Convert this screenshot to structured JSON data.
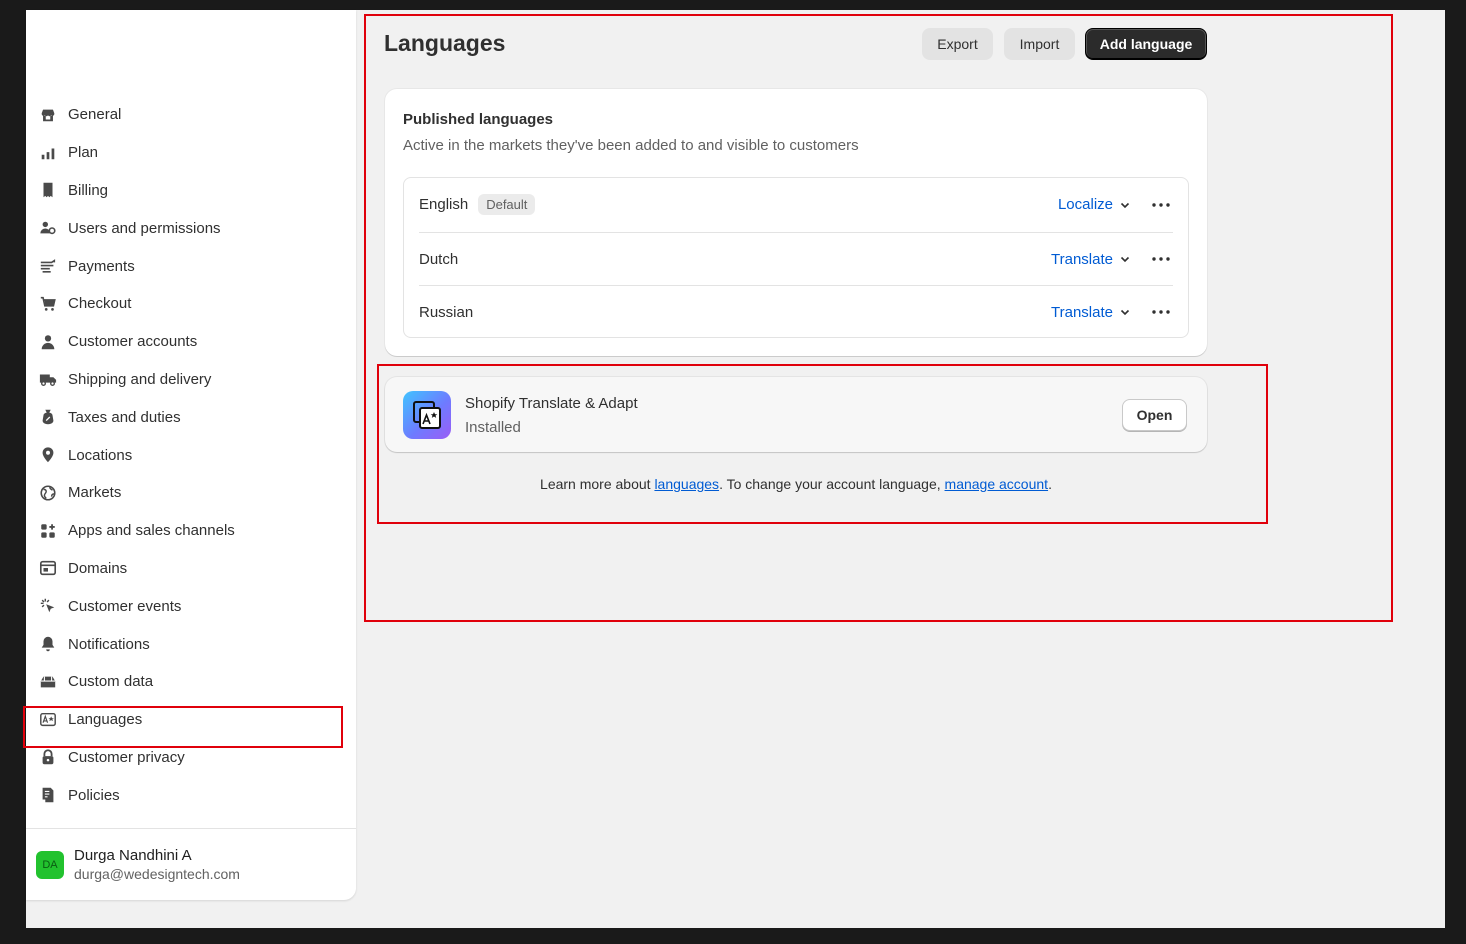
{
  "sidebar": {
    "items": [
      {
        "label": "General",
        "icon": "store-icon"
      },
      {
        "label": "Plan",
        "icon": "plan-icon"
      },
      {
        "label": "Billing",
        "icon": "billing-icon"
      },
      {
        "label": "Users and permissions",
        "icon": "users-icon"
      },
      {
        "label": "Payments",
        "icon": "payments-icon"
      },
      {
        "label": "Checkout",
        "icon": "cart-icon"
      },
      {
        "label": "Customer accounts",
        "icon": "person-icon"
      },
      {
        "label": "Shipping and delivery",
        "icon": "truck-icon"
      },
      {
        "label": "Taxes and duties",
        "icon": "tax-icon"
      },
      {
        "label": "Locations",
        "icon": "location-icon"
      },
      {
        "label": "Markets",
        "icon": "globe-icon"
      },
      {
        "label": "Apps and sales channels",
        "icon": "apps-icon"
      },
      {
        "label": "Domains",
        "icon": "domain-icon"
      },
      {
        "label": "Customer events",
        "icon": "events-icon"
      },
      {
        "label": "Notifications",
        "icon": "bell-icon"
      },
      {
        "label": "Custom data",
        "icon": "custom-data-icon"
      },
      {
        "label": "Languages",
        "icon": "language-icon"
      },
      {
        "label": "Customer privacy",
        "icon": "lock-icon"
      },
      {
        "label": "Policies",
        "icon": "policies-icon"
      }
    ],
    "user": {
      "initials": "DA",
      "name": "Durga Nandhini A",
      "email": "durga@wedesigntech.com"
    }
  },
  "header": {
    "title": "Languages",
    "export_label": "Export",
    "import_label": "Import",
    "add_label": "Add language"
  },
  "published": {
    "title": "Published languages",
    "subtitle": "Active in the markets they've been added to and visible to customers",
    "languages": [
      {
        "name": "English",
        "badge": "Default",
        "action": "Localize"
      },
      {
        "name": "Dutch",
        "badge": "",
        "action": "Translate"
      },
      {
        "name": "Russian",
        "badge": "",
        "action": "Translate"
      }
    ]
  },
  "app": {
    "name": "Shopify Translate & Adapt",
    "status": "Installed",
    "open_label": "Open"
  },
  "footer": {
    "prefix": "Learn more about ",
    "link1": "languages",
    "middle": ". To change your account language, ",
    "link2": "manage account",
    "suffix": "."
  },
  "colors": {
    "accent": "#005bd3",
    "annotation": "#e0000b",
    "primary_button": "#2b2b2b"
  }
}
